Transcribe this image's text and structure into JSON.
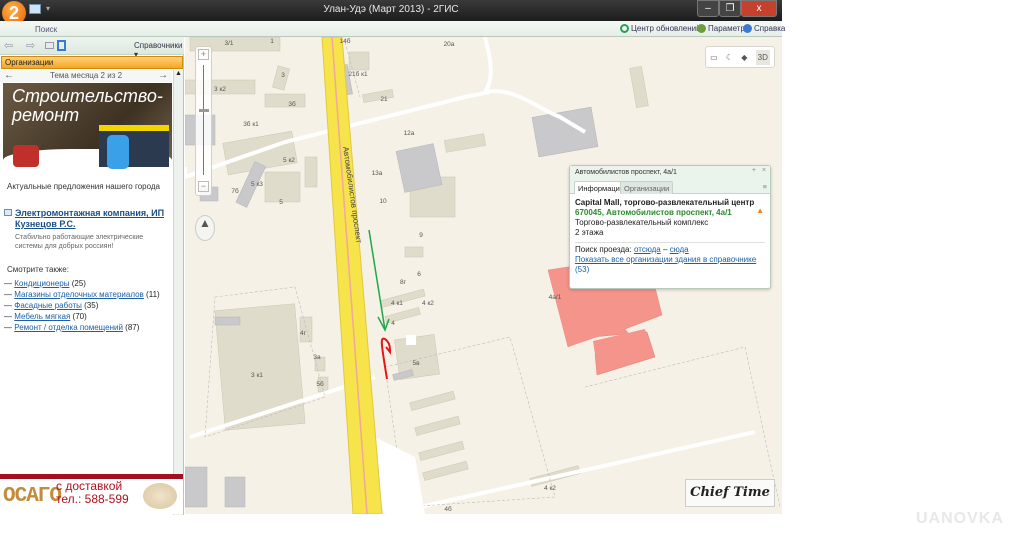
{
  "window": {
    "title": "Улан-Удэ (Март 2013) - 2ГИС",
    "logo": "2",
    "minimize": "–",
    "restore": "❐",
    "close": "x"
  },
  "ribbon": {
    "search_tab": "Поиск",
    "updates": "Центр обновлений",
    "settings": "Параметры",
    "help": "Справка"
  },
  "left": {
    "directories": "Справочники",
    "section": "Организации",
    "theme": "Тема месяца 2 из 2",
    "ad_title_1": "Строительство-",
    "ad_title_2": "ремонт",
    "offers": "Актуальные предложения нашего города",
    "company": {
      "name": "Электромонтажная компания, ИП Кузнецов Р.С.",
      "desc": "Стабильно работающие электрические системы для добрых россиян!"
    },
    "see_also": "Смотрите также:",
    "links": [
      {
        "label": "Кондиционеры",
        "count": "(25)"
      },
      {
        "label": "Магазины отделочных материалов",
        "count": "(11)"
      },
      {
        "label": "Фасадные работы",
        "count": "(35)"
      },
      {
        "label": "Мебель мягкая",
        "count": "(70)"
      },
      {
        "label": "Ремонт / отделка помещений",
        "count": "(87)"
      }
    ],
    "bottom_ad": {
      "osago": "ОСАГО",
      "line1": "с доставкой",
      "line2": "тел.: 588-599"
    }
  },
  "map": {
    "street": "Автомобилистов проспект",
    "tools_3d": "3D",
    "watermark": "Chief Time",
    "labels": [
      "3/1",
      "1",
      "14б",
      "20а",
      "21б к1",
      "3",
      "3 к2",
      "3б",
      "3б к1",
      "21",
      "12а",
      "5 к2",
      "5 к3",
      "7б",
      "5",
      "13а",
      "10",
      "9",
      "6",
      "8г",
      "4 к1",
      "4 к2",
      "4г",
      "4",
      "3а",
      "3 к1",
      "5б",
      "5в",
      "4а/1",
      "4 к2",
      "4б"
    ]
  },
  "popup": {
    "header": "Автомобилистов проспект, 4а/1",
    "tab_info": "Информация",
    "tab_orgs": "Организации",
    "name": "Capital Mall, торгово-развлекательный центр",
    "address": "670045, Автомобилистов проспект, 4а/1",
    "type": "Торгово-развлекательный комплекс",
    "floors": "2 этажа",
    "route_label": "Поиск проезда:",
    "route_from": "отсюда",
    "route_dash": "–",
    "route_to": "сюда",
    "show_all": "Показать все организации здания в справочнике",
    "show_all_count": "(53)"
  },
  "watermark": "UANOVKA",
  "colors": {
    "accent": "#f5a623",
    "highlight_building": "#f4948a",
    "road": "#f7e34a"
  }
}
